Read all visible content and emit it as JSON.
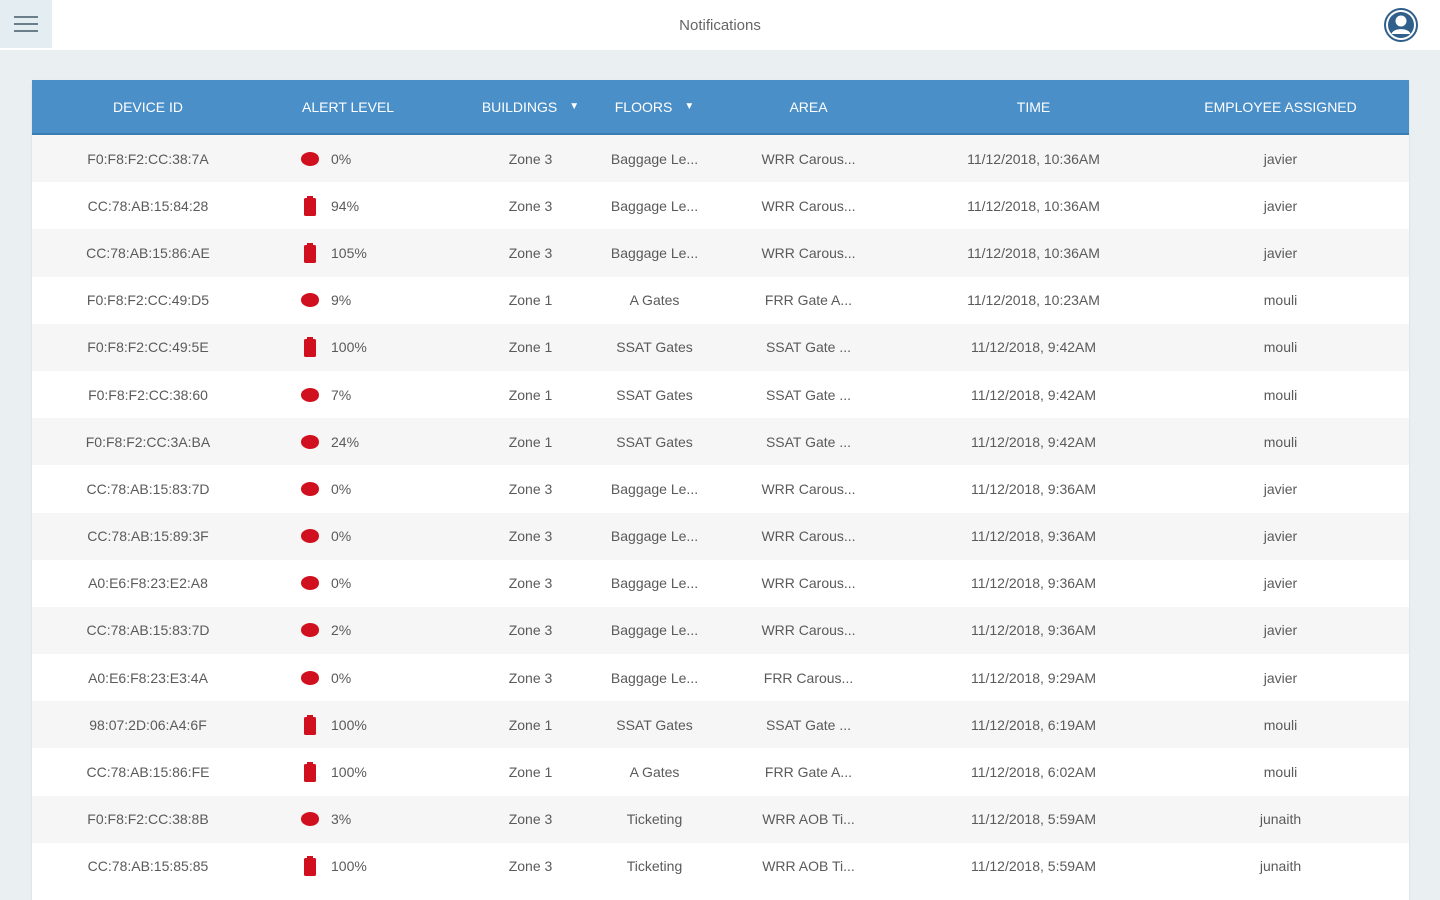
{
  "header": {
    "title": "Notifications"
  },
  "icons": {
    "menu": "hamburger-menu-icon",
    "account": "user-account-icon",
    "sort": "caret-down-icon"
  },
  "colors": {
    "header_bg": "#4a8fc8",
    "alert_red": "#d1101f"
  },
  "table": {
    "columns": [
      {
        "label": "DEVICE ID",
        "sortable": false
      },
      {
        "label": "ALERT LEVEL",
        "sortable": false
      },
      {
        "label": "BUILDINGS",
        "sortable": true
      },
      {
        "label": "FLOORS",
        "sortable": true
      },
      {
        "label": "AREA",
        "sortable": false
      },
      {
        "label": "TIME",
        "sortable": false
      },
      {
        "label": "EMPLOYEE ASSIGNED",
        "sortable": false
      }
    ],
    "rows": [
      {
        "device": "F0:F8:F2:CC:38:7A",
        "icon": "drop",
        "level": "0%",
        "building": "Zone 3",
        "floor": "Baggage Le...",
        "area": "WRR Carous...",
        "time": "11/12/2018, 10:36AM",
        "employee": "javier"
      },
      {
        "device": "CC:78:AB:15:84:28",
        "icon": "battery",
        "level": "94%",
        "building": "Zone 3",
        "floor": "Baggage Le...",
        "area": "WRR Carous...",
        "time": "11/12/2018, 10:36AM",
        "employee": "javier"
      },
      {
        "device": "CC:78:AB:15:86:AE",
        "icon": "battery",
        "level": "105%",
        "building": "Zone 3",
        "floor": "Baggage Le...",
        "area": "WRR Carous...",
        "time": "11/12/2018, 10:36AM",
        "employee": "javier"
      },
      {
        "device": "F0:F8:F2:CC:49:D5",
        "icon": "drop",
        "level": "9%",
        "building": "Zone 1",
        "floor": "A Gates",
        "area": "FRR Gate A...",
        "time": "11/12/2018, 10:23AM",
        "employee": "mouli"
      },
      {
        "device": "F0:F8:F2:CC:49:5E",
        "icon": "battery",
        "level": "100%",
        "building": "Zone 1",
        "floor": "SSAT Gates",
        "area": "SSAT Gate ...",
        "time": "11/12/2018, 9:42AM",
        "employee": "mouli"
      },
      {
        "device": "F0:F8:F2:CC:38:60",
        "icon": "drop",
        "level": "7%",
        "building": "Zone 1",
        "floor": "SSAT Gates",
        "area": "SSAT Gate ...",
        "time": "11/12/2018, 9:42AM",
        "employee": "mouli"
      },
      {
        "device": "F0:F8:F2:CC:3A:BA",
        "icon": "drop",
        "level": "24%",
        "building": "Zone 1",
        "floor": "SSAT Gates",
        "area": "SSAT Gate ...",
        "time": "11/12/2018, 9:42AM",
        "employee": "mouli"
      },
      {
        "device": "CC:78:AB:15:83:7D",
        "icon": "drop",
        "level": "0%",
        "building": "Zone 3",
        "floor": "Baggage Le...",
        "area": "WRR Carous...",
        "time": "11/12/2018, 9:36AM",
        "employee": "javier"
      },
      {
        "device": "CC:78:AB:15:89:3F",
        "icon": "drop",
        "level": "0%",
        "building": "Zone 3",
        "floor": "Baggage Le...",
        "area": "WRR Carous...",
        "time": "11/12/2018, 9:36AM",
        "employee": "javier"
      },
      {
        "device": "A0:E6:F8:23:E2:A8",
        "icon": "drop",
        "level": "0%",
        "building": "Zone 3",
        "floor": "Baggage Le...",
        "area": "WRR Carous...",
        "time": "11/12/2018, 9:36AM",
        "employee": "javier"
      },
      {
        "device": "CC:78:AB:15:83:7D",
        "icon": "drop",
        "level": "2%",
        "building": "Zone 3",
        "floor": "Baggage Le...",
        "area": "WRR Carous...",
        "time": "11/12/2018, 9:36AM",
        "employee": "javier"
      },
      {
        "device": "A0:E6:F8:23:E3:4A",
        "icon": "drop",
        "level": "0%",
        "building": "Zone 3",
        "floor": "Baggage Le...",
        "area": "FRR Carous...",
        "time": "11/12/2018, 9:29AM",
        "employee": "javier"
      },
      {
        "device": "98:07:2D:06:A4:6F",
        "icon": "battery",
        "level": "100%",
        "building": "Zone 1",
        "floor": "SSAT Gates",
        "area": "SSAT Gate ...",
        "time": "11/12/2018, 6:19AM",
        "employee": "mouli"
      },
      {
        "device": "CC:78:AB:15:86:FE",
        "icon": "battery",
        "level": "100%",
        "building": "Zone 1",
        "floor": "A Gates",
        "area": "FRR Gate A...",
        "time": "11/12/2018, 6:02AM",
        "employee": "mouli"
      },
      {
        "device": "F0:F8:F2:CC:38:8B",
        "icon": "drop",
        "level": "3%",
        "building": "Zone 3",
        "floor": "Ticketing",
        "area": "WRR AOB Ti...",
        "time": "11/12/2018, 5:59AM",
        "employee": "junaith"
      },
      {
        "device": "CC:78:AB:15:85:85",
        "icon": "battery",
        "level": "100%",
        "building": "Zone 3",
        "floor": "Ticketing",
        "area": "WRR AOB Ti...",
        "time": "11/12/2018, 5:59AM",
        "employee": "junaith"
      }
    ]
  }
}
